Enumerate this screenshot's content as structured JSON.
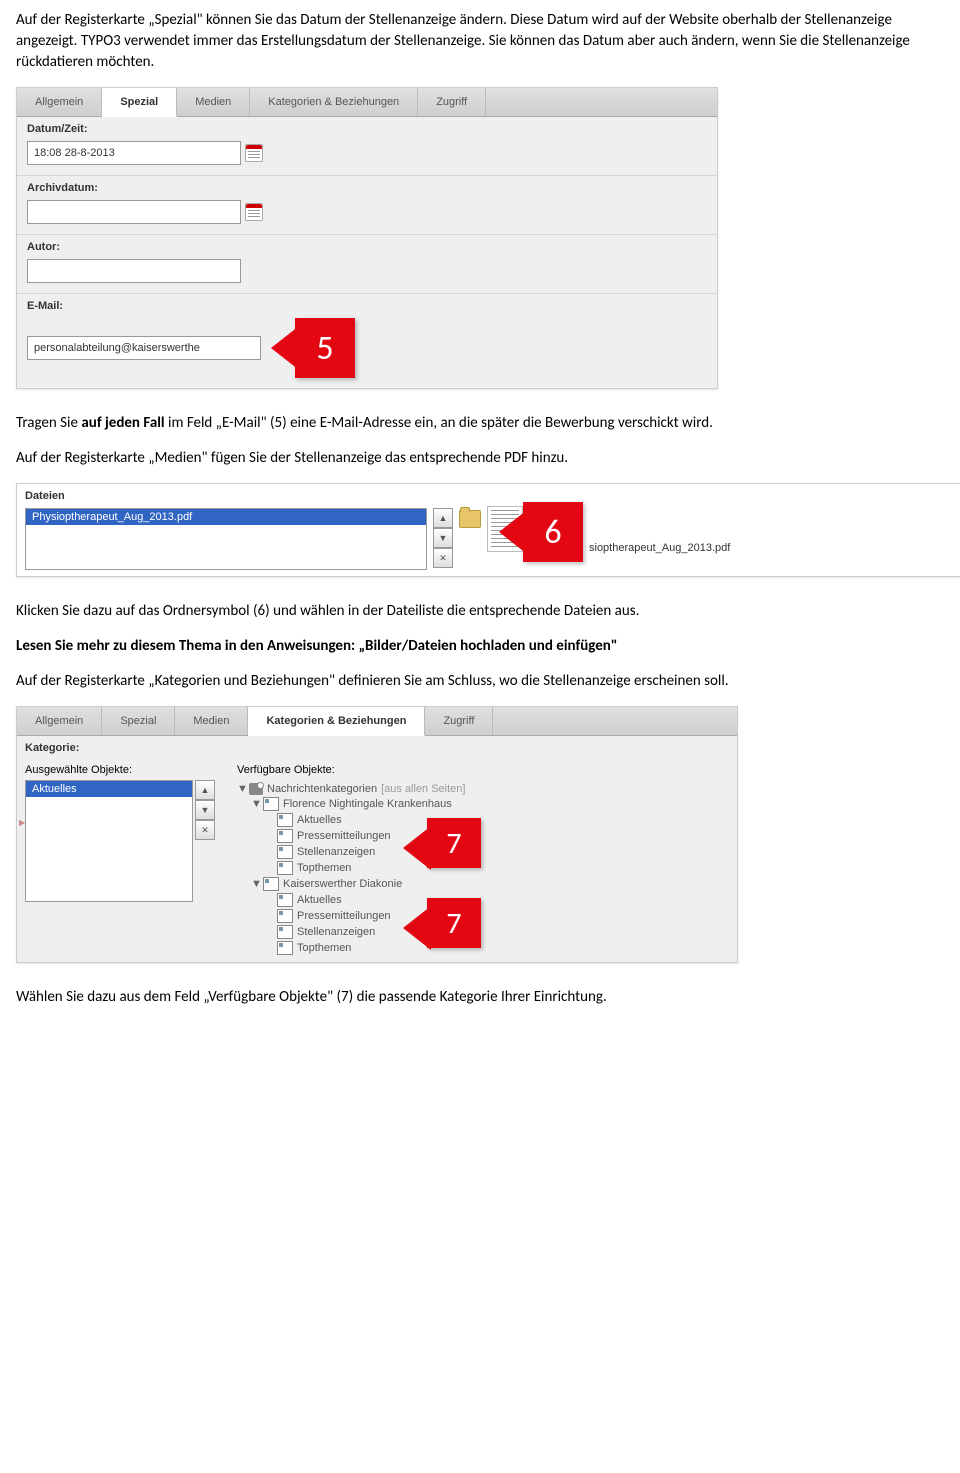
{
  "para1": "Auf der Registerkarte „Spezial\" können Sie das Datum der Stellenanzeige ändern. Diese Datum wird auf der Website oberhalb der Stellenanzeige angezeigt. TYPO3 verwendet immer das Erstellungsdatum der Stellenanzeige. Sie können das Datum aber auch ändern, wenn Sie die Stellenanzeige rückdatieren möchten.",
  "screenshot1": {
    "tabs": {
      "allgemein": "Allgemein",
      "spezial": "Spezial",
      "medien": "Medien",
      "kat": "Kategorien & Beziehungen",
      "zugriff": "Zugriff"
    },
    "fields": {
      "datum_label": "Datum/Zeit:",
      "datum_value": "18:08 28-8-2013",
      "archiv_label": "Archivdatum:",
      "archiv_value": "",
      "autor_label": "Autor:",
      "autor_value": "",
      "email_label": "E-Mail:",
      "email_value": "personalabteilung@kaiserswerthe"
    }
  },
  "callout5": "5",
  "para2a": "Tragen Sie ",
  "para2b": "auf jeden Fall",
  "para2c": " im Feld „E-Mail\" (5) eine E-Mail-Adresse ein, an die später die Bewerbung verschickt wird.",
  "para3": "Auf der Registerkarte „Medien\" fügen Sie der Stellenanzeige das entsprechende PDF hinzu.",
  "screenshot2": {
    "label": "Dateien",
    "option": "Physioptherapeut_Aug_2013.pdf",
    "filename": "sioptherapeut_Aug_2013.pdf",
    "btn_up": "▲",
    "btn_down": "▼",
    "btn_x": "✕"
  },
  "callout6": "6",
  "para4": "Klicken Sie dazu auf das Ordnersymbol (6) und wählen in der Dateiliste die entsprechende Dateien aus.",
  "para5": "Lesen Sie mehr zu diesem Thema in den Anweisungen: „Bilder/Dateien hochladen und einfügen\"",
  "para6": "Auf der Registerkarte „Kategorien und Beziehungen\" definieren Sie am Schluss, wo die Stellenanzeige erscheinen soll.",
  "screenshot3": {
    "tabs": {
      "allgemein": "Allgemein",
      "spezial": "Spezial",
      "medien": "Medien",
      "kat": "Kategorien & Beziehungen",
      "zugriff": "Zugriff"
    },
    "kat_label": "Kategorie:",
    "sel_label": "Ausgewählte Objekte:",
    "avail_label": "Verfügbare Objekte:",
    "selected": "Aktuelles",
    "btn_up": "▲",
    "btn_down": "▼",
    "btn_x": "✕",
    "tree": {
      "root": "Nachrichtenkategorien",
      "root_suffix": "[aus allen Seiten]",
      "n1": "Florence Nightingale Krankenhaus",
      "n1c": {
        "a": "Aktuelles",
        "b": "Pressemitteilungen",
        "c": "Stellenanzeigen",
        "d": "Topthemen"
      },
      "n2": "Kaiserswerther Diakonie",
      "n2c": {
        "a": "Aktuelles",
        "b": "Pressemitteilungen",
        "c": "Stellenanzeigen",
        "d": "Topthemen"
      }
    }
  },
  "callout7": "7",
  "para7": "Wählen Sie dazu aus dem Feld „Verfügbare Objekte\" (7) die passende Kategorie Ihrer Einrichtung."
}
